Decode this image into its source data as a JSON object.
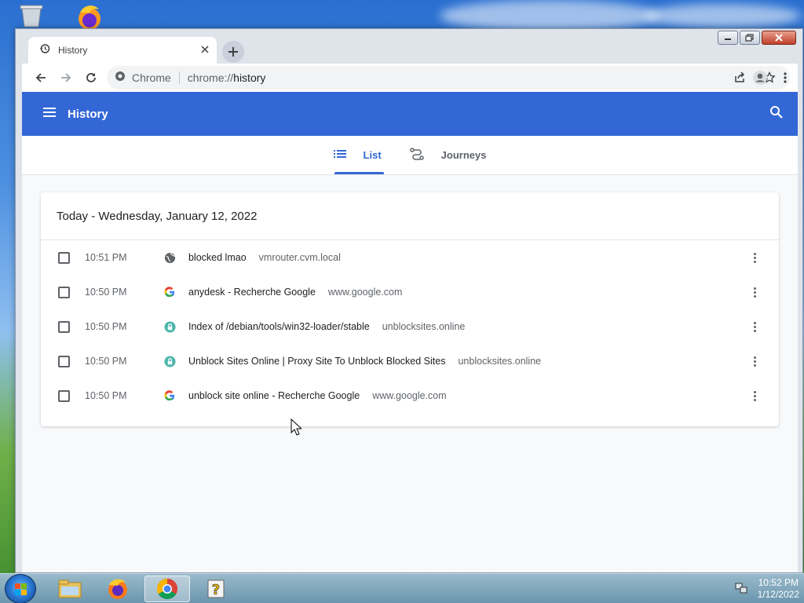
{
  "browser": {
    "tab": {
      "title": "History"
    },
    "omnibox": {
      "site_label": "Chrome",
      "url_scheme": "chrome://",
      "url_path": "history"
    }
  },
  "history": {
    "header_title": "History",
    "tabs": [
      {
        "label": "List",
        "icon": "list-icon",
        "active": true
      },
      {
        "label": "Journeys",
        "icon": "journeys-icon",
        "active": false
      }
    ],
    "date_heading": "Today - Wednesday, January 12, 2022",
    "entries": [
      {
        "time": "10:51 PM",
        "favicon": "globe-icon",
        "title": "blocked lmao",
        "domain": "vmrouter.cvm.local"
      },
      {
        "time": "10:50 PM",
        "favicon": "google-icon",
        "title": "anydesk - Recherche Google",
        "domain": "www.google.com"
      },
      {
        "time": "10:50 PM",
        "favicon": "lock-site-icon",
        "title": "Index of /debian/tools/win32-loader/stable",
        "domain": "unblocksites.online"
      },
      {
        "time": "10:50 PM",
        "favicon": "lock-site-icon",
        "title": "Unblock Sites Online | Proxy Site To Unblock Blocked Sites",
        "domain": "unblocksites.online"
      },
      {
        "time": "10:50 PM",
        "favicon": "google-icon",
        "title": "unblock site online - Recherche Google",
        "domain": "www.google.com"
      }
    ]
  },
  "taskbar": {
    "clock_time": "10:52 PM",
    "clock_date": "1/12/2022",
    "apps": [
      "file-explorer-icon",
      "firefox-icon",
      "chrome-icon",
      "help-icon"
    ]
  },
  "colors": {
    "header_blue": "#3367d6",
    "accent_blue": "#3367d6",
    "page_bg": "#f8f9fb"
  }
}
